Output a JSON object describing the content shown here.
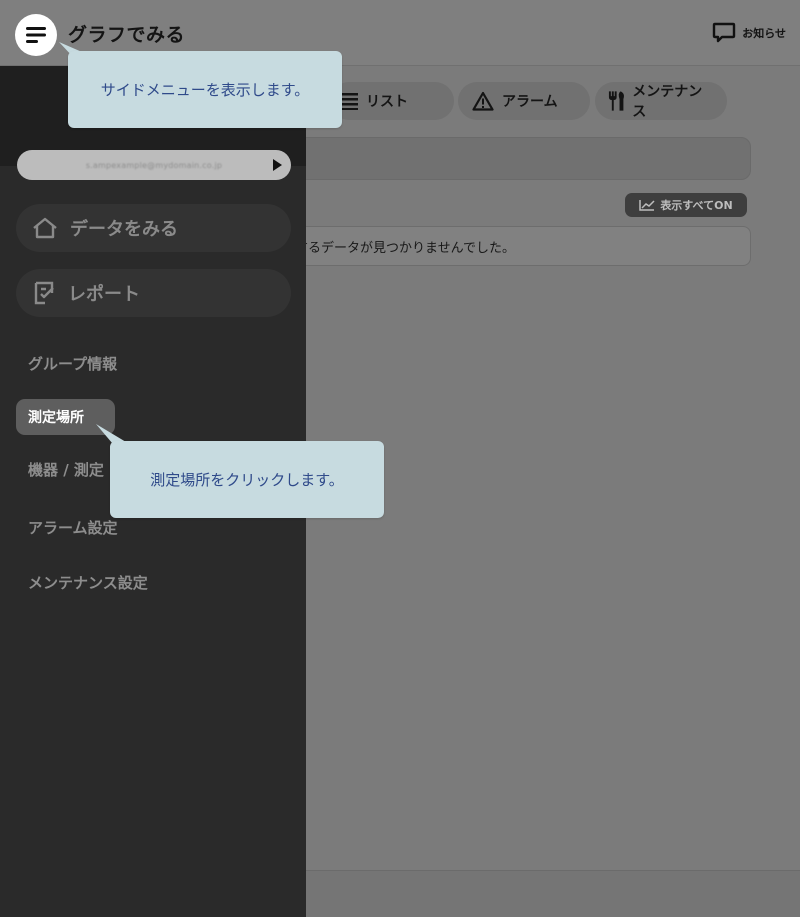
{
  "header": {
    "title": "グラフでみる",
    "notice_label": "お知らせ",
    "menu_icon": "hamburger-menu-icon",
    "notice_icon": "speech-bubble-icon"
  },
  "tabs": [
    {
      "label": "リスト",
      "icon": "list-icon"
    },
    {
      "label": "アラーム",
      "icon": "warning-triangle-icon"
    },
    {
      "label": "メンテナンス",
      "icon": "tools-icon"
    }
  ],
  "main": {
    "show_all_label": "表示すべてON",
    "show_all_icon": "line-chart-icon",
    "notfound_text": "するデータが見つかりませんでした。"
  },
  "sidebar": {
    "account_email": "s.ampexample@mydomain.co.jp",
    "nav": [
      {
        "label": "データをみる",
        "icon": "home-icon"
      },
      {
        "label": "レポート",
        "icon": "report-icon"
      }
    ],
    "links": {
      "group_info": "グループ情報",
      "place": "測定場所",
      "device": "機器 / 測定",
      "alarm_settings": "アラーム設定",
      "maint_settings": "メンテナンス設定"
    }
  },
  "callouts": {
    "sidebar_menu": "サイドメニューを表示します。",
    "click_place": "測定場所をクリックします。"
  },
  "colors": {
    "overlay_bg": "#7b7b7b",
    "sidebar_bg": "#2a2a2a",
    "callout_bg": "#c7dbe0",
    "callout_text": "#2f4a8a",
    "active_item_bg": "#5e5e5e"
  }
}
